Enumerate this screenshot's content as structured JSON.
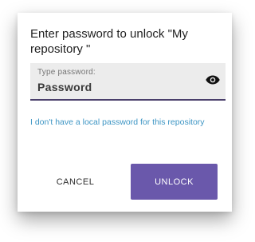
{
  "dialog": {
    "title": "Enter password to unlock \"My repository \"",
    "password_field": {
      "label": "Type password:",
      "placeholder": "Password",
      "value": ""
    },
    "visibility_icon": "eye-icon",
    "local_password_link": "I don't have a local password for this repository",
    "cancel_label": "CANCEL",
    "unlock_label": "UNLOCK"
  },
  "colors": {
    "accent": "#6a58ab",
    "link": "#3d95c4",
    "field_background": "#ececec",
    "field_underline": "#4a3f6b"
  }
}
